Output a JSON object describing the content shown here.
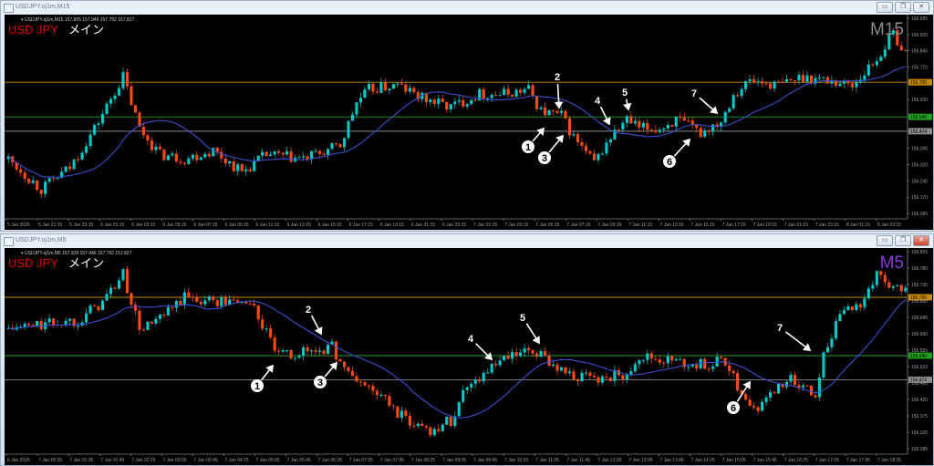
{
  "windows": [
    {
      "title": "USDJPY.oj1m,M15",
      "info": "USDJPY.oj1m,M15  157.905 157.946 157.792 157.827",
      "symbol_label": "USD JPY",
      "sub_label": "メイン",
      "timeframe": "M15",
      "timeframe_color": "#8a8a8a",
      "price_ticks": [
        "156.995",
        "156.920",
        "156.845",
        "156.770",
        "156.620",
        "156.395",
        "156.320",
        "156.245",
        "156.170",
        "156.095"
      ],
      "price_range": [
        156.095,
        156.995
      ],
      "levels": [
        {
          "price": 156.7,
          "label": "156.700",
          "color": "#c88a00"
        },
        {
          "price": 156.54,
          "label": "156.540",
          "color": "#1ea01e"
        },
        {
          "price": 156.474,
          "label": "156.474",
          "color": "#8a8a8a"
        }
      ],
      "time_labels": [
        "5 Jan 2026",
        "5 Jan 21:15",
        "5 Jan 23:15",
        "6 Jan 01:15",
        "6 Jan 03:15",
        "6 Jan 05:15",
        "6 Jan 07:15",
        "6 Jan 09:15",
        "6 Jan 11:15",
        "6 Jan 13:15",
        "6 Jan 15:15",
        "6 Jan 17:15",
        "6 Jan 19:15",
        "6 Jan 21:15",
        "6 Jan 23:15",
        "7 Jan 01:15",
        "7 Jan 03:15",
        "7 Jan 05:15",
        "7 Jan 07:15",
        "7 Jan 09:15",
        "7 Jan 11:15",
        "7 Jan 13:15",
        "7 Jan 15:15",
        "7 Jan 17:15",
        "7 Jan 19:15",
        "7 Jan 21:15",
        "7 Jan 23:15",
        "8 Jan 01:15",
        "8 Jan 03:15"
      ],
      "annotations": [
        {
          "label": "1",
          "circled": true
        },
        {
          "label": "2",
          "circled": false
        },
        {
          "label": "3",
          "circled": true
        },
        {
          "label": "4",
          "circled": false
        },
        {
          "label": "5",
          "circled": false
        },
        {
          "label": "6",
          "circled": true
        },
        {
          "label": "7",
          "circled": false
        }
      ],
      "buttons": {
        "minimize": "▭",
        "restore": "❐",
        "close": "✕"
      }
    },
    {
      "title": "USDJPY.oj1m,M5",
      "info": "USDJPY.oj1m,M5  157.928 157.946 157.792 157.827",
      "symbol_label": "USD JPY",
      "sub_label": "メイン",
      "timeframe": "M5",
      "timeframe_color": "#8a3ad8",
      "price_ticks": [
        "156.825",
        "156.780",
        "156.735",
        "156.690",
        "156.645",
        "156.600",
        "156.555",
        "156.510",
        "156.465",
        "156.420",
        "156.375",
        "156.330",
        "156.285"
      ],
      "price_range": [
        156.285,
        156.825
      ],
      "levels": [
        {
          "price": 156.7,
          "label": "156.700",
          "color": "#c88a00"
        },
        {
          "price": 156.54,
          "label": "156.540",
          "color": "#1ea01e"
        },
        {
          "price": 156.474,
          "label": "156.474",
          "color": "#8a8a8a"
        }
      ],
      "time_labels": [
        "6 Jan 2026",
        "7 Jan 00:25",
        "7 Jan 01:05",
        "7 Jan 01:45",
        "7 Jan 02:25",
        "7 Jan 03:05",
        "7 Jan 03:45",
        "7 Jan 04:25",
        "7 Jan 05:05",
        "7 Jan 05:45",
        "7 Jan 06:25",
        "7 Jan 07:05",
        "7 Jan 07:45",
        "7 Jan 08:25",
        "7 Jan 09:05",
        "7 Jan 09:45",
        "7 Jan 10:25",
        "7 Jan 11:05",
        "7 Jan 11:45",
        "7 Jan 12:25",
        "7 Jan 13:05",
        "7 Jan 13:45",
        "7 Jan 14:25",
        "7 Jan 15:05",
        "7 Jan 15:45",
        "7 Jan 16:25",
        "7 Jan 17:05",
        "7 Jan 17:45",
        "7 Jan 18:25"
      ],
      "annotations": [
        {
          "label": "1",
          "circled": true
        },
        {
          "label": "2",
          "circled": false
        },
        {
          "label": "3",
          "circled": true
        },
        {
          "label": "4",
          "circled": false
        },
        {
          "label": "5",
          "circled": false
        },
        {
          "label": "6",
          "circled": true
        },
        {
          "label": "7",
          "circled": false
        }
      ],
      "buttons": {
        "minimize": "▭",
        "restore": "❐",
        "close": "✕"
      }
    }
  ],
  "chart_data": [
    {
      "type": "candlestick",
      "title": "USDJPY M15",
      "bull_color": "#00c8c8",
      "bear_color": "#ff4a10",
      "ma_color": "#3a50d0",
      "close_path": [
        [
          0,
          156.346
        ],
        [
          8,
          156.206
        ],
        [
          15,
          156.306
        ],
        [
          21,
          156.486
        ],
        [
          28,
          156.726
        ],
        [
          32,
          156.486
        ],
        [
          37,
          156.366
        ],
        [
          43,
          156.346
        ],
        [
          50,
          156.386
        ],
        [
          57,
          156.286
        ],
        [
          63,
          156.366
        ],
        [
          72,
          156.346
        ],
        [
          81,
          156.406
        ],
        [
          85,
          156.606
        ],
        [
          88,
          156.666
        ],
        [
          95,
          156.686
        ],
        [
          101,
          156.626
        ],
        [
          108,
          156.586
        ],
        [
          115,
          156.646
        ],
        [
          121,
          156.646
        ],
        [
          127,
          156.666
        ],
        [
          130,
          156.566
        ],
        [
          135,
          156.546
        ],
        [
          138,
          156.446
        ],
        [
          143,
          156.326
        ],
        [
          147,
          156.446
        ],
        [
          151,
          156.526
        ],
        [
          154,
          156.486
        ],
        [
          159,
          156.486
        ],
        [
          163,
          156.526
        ],
        [
          169,
          156.466
        ],
        [
          174,
          156.526
        ],
        [
          177,
          156.646
        ],
        [
          181,
          156.706
        ],
        [
          188,
          156.686
        ],
        [
          194,
          156.726
        ],
        [
          201,
          156.706
        ],
        [
          206,
          156.686
        ],
        [
          212,
          156.806
        ],
        [
          216,
          156.926
        ],
        [
          219,
          156.826
        ]
      ]
    },
    {
      "type": "candlestick",
      "title": "USDJPY M5",
      "bull_color": "#00c8c8",
      "bear_color": "#ff4a10",
      "ma_color": "#3a50d0",
      "close_path": [
        [
          0,
          156.613
        ],
        [
          8,
          156.625
        ],
        [
          17,
          156.638
        ],
        [
          23,
          156.688
        ],
        [
          28,
          156.762
        ],
        [
          32,
          156.613
        ],
        [
          37,
          156.638
        ],
        [
          43,
          156.7
        ],
        [
          52,
          156.688
        ],
        [
          59,
          156.688
        ],
        [
          66,
          156.538
        ],
        [
          72,
          156.55
        ],
        [
          79,
          156.563
        ],
        [
          83,
          156.488
        ],
        [
          90,
          156.438
        ],
        [
          97,
          156.363
        ],
        [
          103,
          156.338
        ],
        [
          108,
          156.363
        ],
        [
          112,
          156.463
        ],
        [
          119,
          156.513
        ],
        [
          123,
          156.538
        ],
        [
          128,
          156.55
        ],
        [
          132,
          156.525
        ],
        [
          137,
          156.488
        ],
        [
          143,
          156.475
        ],
        [
          150,
          156.488
        ],
        [
          154,
          156.538
        ],
        [
          161,
          156.525
        ],
        [
          168,
          156.513
        ],
        [
          175,
          156.525
        ],
        [
          179,
          156.438
        ],
        [
          183,
          156.388
        ],
        [
          188,
          156.463
        ],
        [
          192,
          156.475
        ],
        [
          197,
          156.438
        ],
        [
          199,
          156.538
        ],
        [
          203,
          156.663
        ],
        [
          208,
          156.688
        ],
        [
          212,
          156.762
        ],
        [
          215,
          156.738
        ],
        [
          219,
          156.713
        ]
      ]
    }
  ]
}
